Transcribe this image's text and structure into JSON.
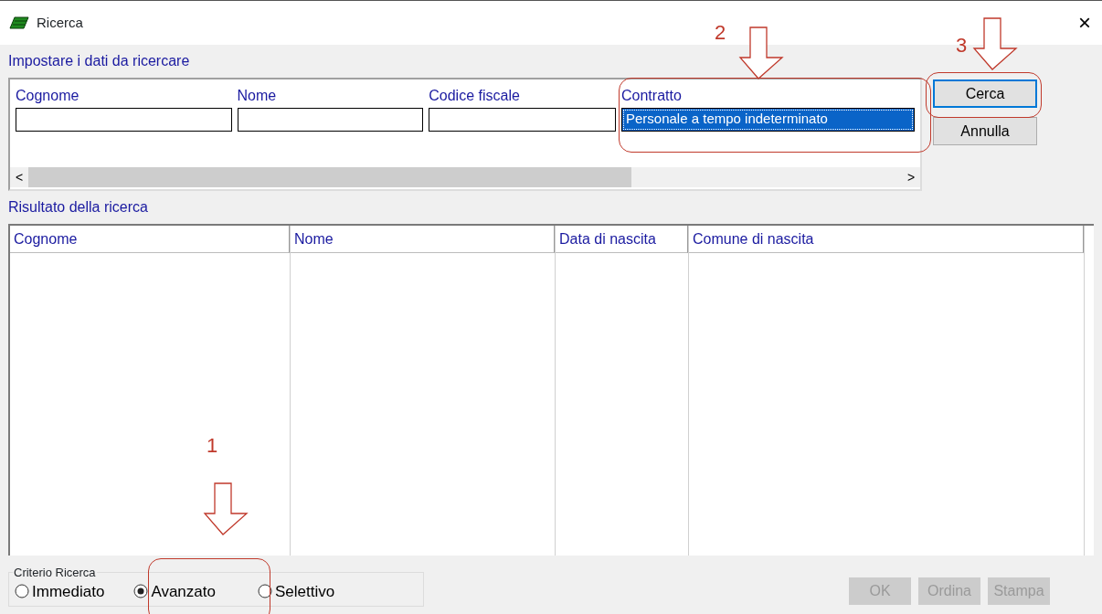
{
  "window": {
    "title": "Ricerca",
    "close": "×"
  },
  "search_panel": {
    "title": "Impostare i dati da ricercare",
    "fields": [
      {
        "label": "Cognome",
        "selected": false
      },
      {
        "label": "Nome",
        "selected": false
      },
      {
        "label": "Codice fiscale",
        "selected": false
      },
      {
        "label": "Contratto",
        "value": "Personale a tempo indeterminato",
        "selected": true
      }
    ],
    "scroll_left": "<",
    "scroll_right": ">"
  },
  "side_buttons": [
    {
      "label": "Cerca",
      "focused": true
    },
    {
      "label": "Annulla",
      "focused": false
    }
  ],
  "results": {
    "title": "Risultato della ricerca",
    "columns": [
      "Cognome",
      "Nome",
      "Data di nascita",
      "Comune di nascita"
    ]
  },
  "criteria": {
    "title": "Criterio Ricerca",
    "options": [
      {
        "label": "Immediato",
        "selected": false
      },
      {
        "label": "Avanzato",
        "selected": true
      },
      {
        "label": "Selettivo",
        "selected": false
      }
    ]
  },
  "footer_buttons": [
    {
      "label": "OK",
      "disabled": true
    },
    {
      "label": "Ordina",
      "disabled": true
    },
    {
      "label": "Stampa",
      "disabled": true
    }
  ],
  "annotations": [
    {
      "number": "1"
    },
    {
      "number": "2"
    },
    {
      "number": "3"
    }
  ]
}
